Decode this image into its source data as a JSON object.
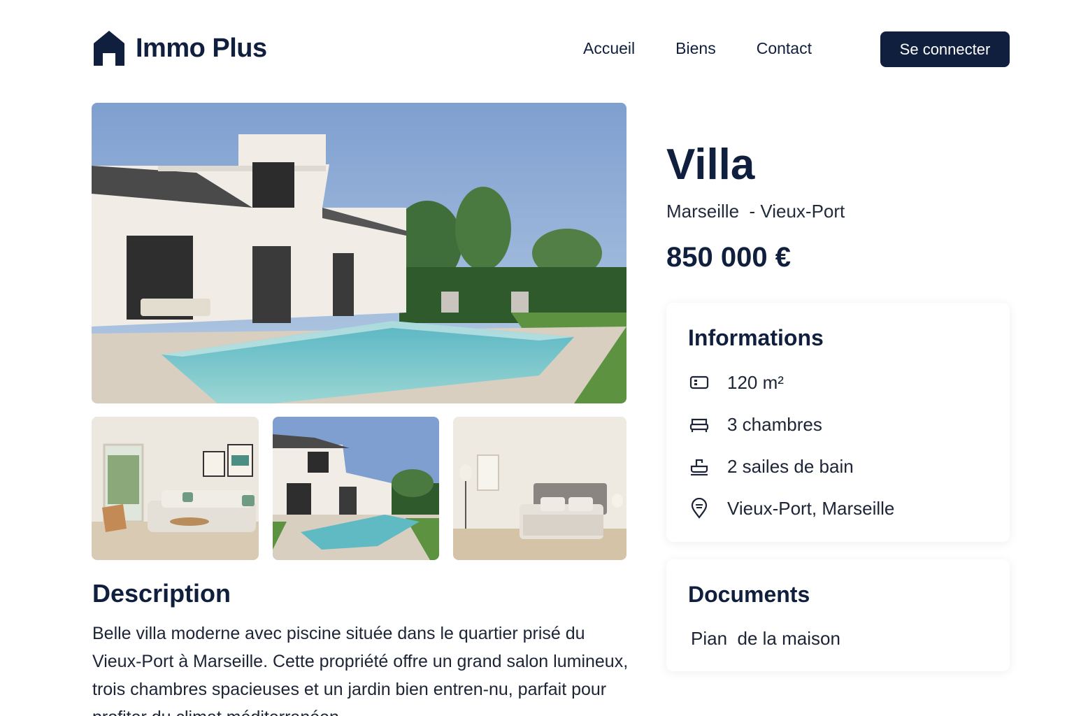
{
  "brand": {
    "name": "Immo Plus",
    "icon": "house-icon"
  },
  "nav": {
    "items": [
      {
        "label": "Accueil"
      },
      {
        "label": "Biens"
      },
      {
        "label": "Contact"
      }
    ],
    "login_label": "Se connecter"
  },
  "colors": {
    "primary": "#0f1f3d",
    "background": "#ffffff"
  },
  "gallery": {
    "main": "villa-with-pool-photo",
    "thumbnails": [
      "living-room-photo",
      "villa-pool-photo",
      "bedroom-photo"
    ]
  },
  "property": {
    "title": "Villa",
    "location": "Marseille  - Vieux-Port",
    "price": "850 000 €"
  },
  "info": {
    "title": "Informations",
    "rows": [
      {
        "icon": "area-icon",
        "text": "120 m²"
      },
      {
        "icon": "bed-icon",
        "text": "3 chambres"
      },
      {
        "icon": "bath-icon",
        "text": "2 sailes de bain"
      },
      {
        "icon": "location-pin-icon",
        "text": "Vieux-Port, Marseille"
      }
    ]
  },
  "documents": {
    "title": "Documents",
    "items": [
      {
        "label": "Pian  de la maison"
      }
    ]
  },
  "description": {
    "title": "Description",
    "text": "Belle villa moderne avec piscine située dans le quartier prisé du Vieux-Port à Marseille. Cette propriété offre un grand salon lumineux, trois chambres spacieuses et un jardin bien entren-nu, parfait pour profiter du climat méditerranéen."
  }
}
